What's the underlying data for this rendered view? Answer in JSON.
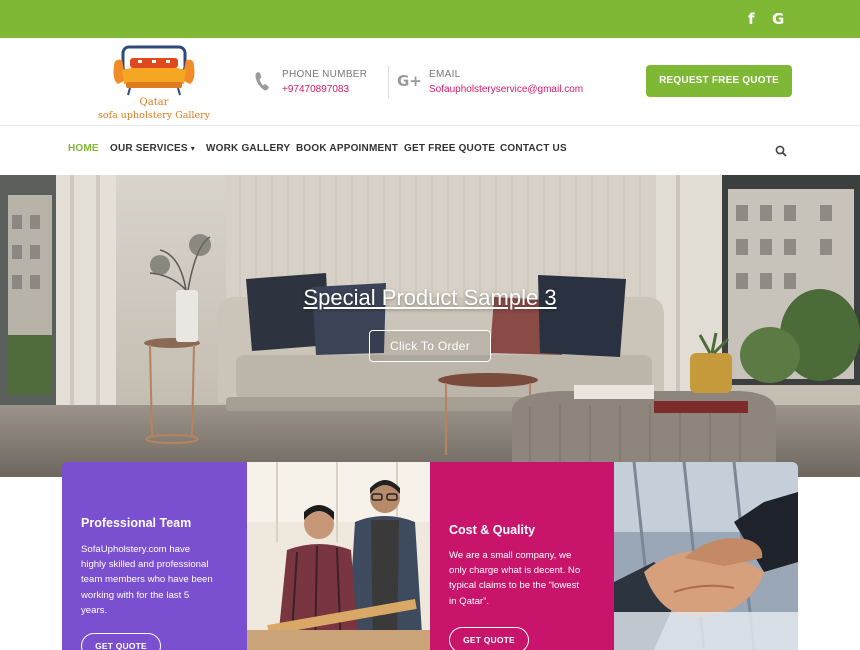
{
  "topbar": {
    "background": "#7fb834",
    "social": [
      {
        "icon": "facebook-icon",
        "glyph": "f"
      },
      {
        "icon": "google-icon",
        "glyph": "G"
      }
    ]
  },
  "header": {
    "logo": {
      "line1": "Qatar",
      "line2": "sofa upholstery Gallery"
    },
    "phone": {
      "icon": "phone-icon",
      "title": "PHONE NUMBER",
      "value": "+97470897083"
    },
    "email": {
      "icon": "google-plus-icon",
      "glyph": "G+",
      "title": "EMAIL",
      "value": "Sofaupholsteryservice@gmail.com"
    },
    "quote_button": "REQUEST FREE QUOTE"
  },
  "nav": {
    "items": [
      {
        "label": "HOME",
        "active": true
      },
      {
        "label": "OUR SERVICES",
        "dropdown": true
      },
      {
        "label": "WORK GALLERY"
      },
      {
        "label": "BOOK APPOINMENT"
      },
      {
        "label": "GET FREE QUOTE"
      },
      {
        "label": "CONTACT US"
      }
    ],
    "search_icon": "search-icon"
  },
  "hero": {
    "title": "Special Product Sample 3",
    "button": "Click To Order"
  },
  "features": [
    {
      "title": "Professional Team",
      "text": [
        "SofaUpholstery.com have",
        "highly skilled and professional",
        "team members who have been",
        "working with for the last 5",
        "years."
      ],
      "button": "GET QUOTE",
      "color": "#7a4fd0"
    },
    {
      "title": "Cost & Quality",
      "text": [
        "We are a small company, we",
        "only charge what is decent. No",
        "typical claims to be the “lowest",
        "in Qatar”."
      ],
      "button": "GET QUOTE",
      "color": "#c8156b"
    }
  ],
  "colors": {
    "accent": "#7fb834",
    "email": "#d61a6a"
  }
}
